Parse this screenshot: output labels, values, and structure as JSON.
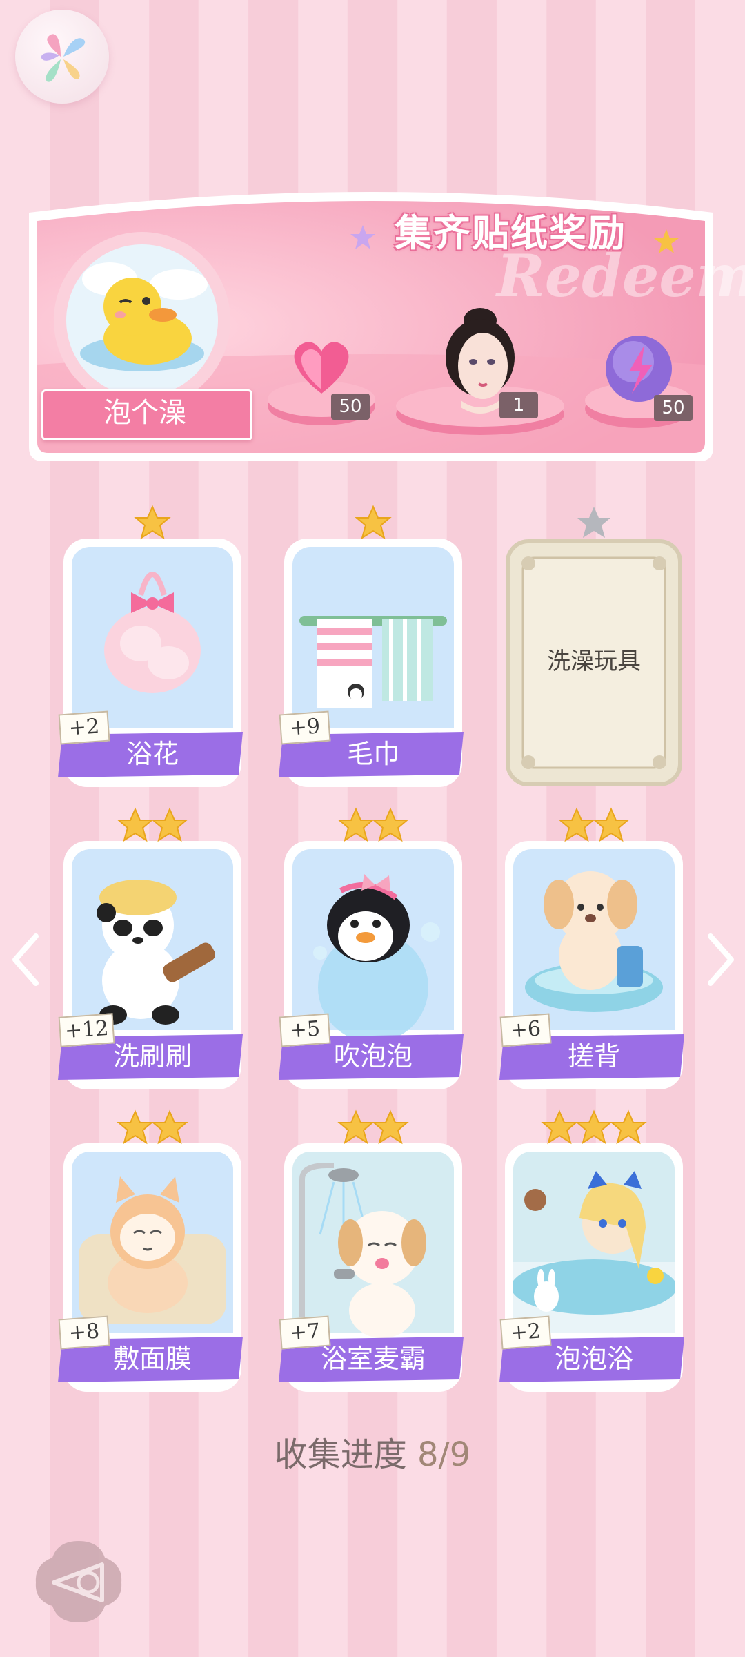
{
  "banner": {
    "title": "集齐贴纸奖励",
    "deco_text": "Redeem",
    "theme": "泡个澡",
    "rewards": [
      {
        "icon": "heart-gem-icon",
        "count": "50"
      },
      {
        "icon": "character-portrait-icon",
        "count": "1"
      },
      {
        "icon": "energy-orb-icon",
        "count": "50"
      }
    ]
  },
  "cards": [
    {
      "label": "浴花",
      "count": "+2",
      "stars": 1,
      "icon": "bath-puff-icon",
      "locked": false
    },
    {
      "label": "毛巾",
      "count": "+9",
      "stars": 1,
      "icon": "towel-icon",
      "locked": false
    },
    {
      "label": "洗澡玩具",
      "count": "",
      "stars": 1,
      "icon": "",
      "locked": true
    },
    {
      "label": "洗刷刷",
      "count": "+12",
      "stars": 2,
      "icon": "panda-scrub-icon",
      "locked": false
    },
    {
      "label": "吹泡泡",
      "count": "+5",
      "stars": 2,
      "icon": "penguin-bubble-icon",
      "locked": false
    },
    {
      "label": "搓背",
      "count": "+6",
      "stars": 2,
      "icon": "puppy-tub-icon",
      "locked": false
    },
    {
      "label": "敷面膜",
      "count": "+8",
      "stars": 2,
      "icon": "cat-face-mask-icon",
      "locked": false
    },
    {
      "label": "浴室麦霸",
      "count": "+7",
      "stars": 2,
      "icon": "dog-shower-singing-icon",
      "locked": false
    },
    {
      "label": "泡泡浴",
      "count": "+2",
      "stars": 3,
      "icon": "girl-bubble-bath-icon",
      "locked": false
    }
  ],
  "progress": {
    "label": "收集进度",
    "value": "8/9"
  },
  "colors": {
    "accent_purple": "#9b6ee6",
    "banner_pink": "#f7a9c0",
    "star_gold": "#f7c243",
    "star_gray": "#b5b7bd"
  }
}
